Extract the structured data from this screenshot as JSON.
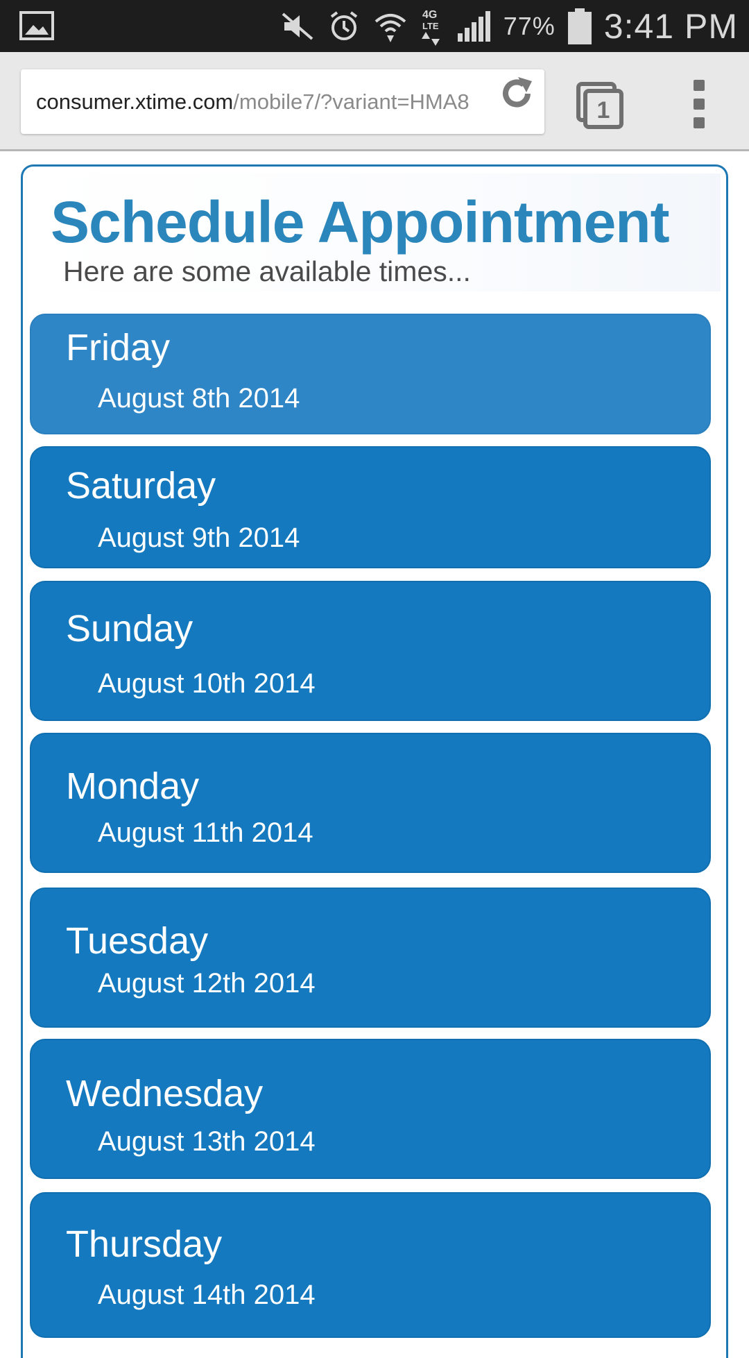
{
  "status_bar": {
    "battery_percent": "77%",
    "time": "3:41 PM",
    "icons": [
      "image-icon",
      "mute-icon",
      "alarm-icon",
      "wifi-icon",
      "lte-4g-icon",
      "signal-icon",
      "battery-icon"
    ]
  },
  "browser": {
    "url_host": "consumer.xtime.com",
    "url_path": "/mobile7/?variant=HMA8",
    "tab_count": "1"
  },
  "page": {
    "title": "Schedule Appointment",
    "subtitle": "Here are some available times...",
    "days": [
      {
        "day": "Friday",
        "date": "August 8th 2014",
        "selected": true
      },
      {
        "day": "Saturday",
        "date": "August 9th 2014",
        "selected": false
      },
      {
        "day": "Sunday",
        "date": "August 10th 2014",
        "selected": false
      },
      {
        "day": "Monday",
        "date": "August 11th 2014",
        "selected": false
      },
      {
        "day": "Tuesday",
        "date": "August 12th 2014",
        "selected": false
      },
      {
        "day": "Wednesday",
        "date": "August 13th 2014",
        "selected": false
      },
      {
        "day": "Thursday",
        "date": "August 14th 2014",
        "selected": false
      }
    ]
  },
  "colors": {
    "accent": "#1479bf",
    "selected": "#2f86c6",
    "title": "#2a86bb",
    "status_bar": "#1d1d1d"
  }
}
